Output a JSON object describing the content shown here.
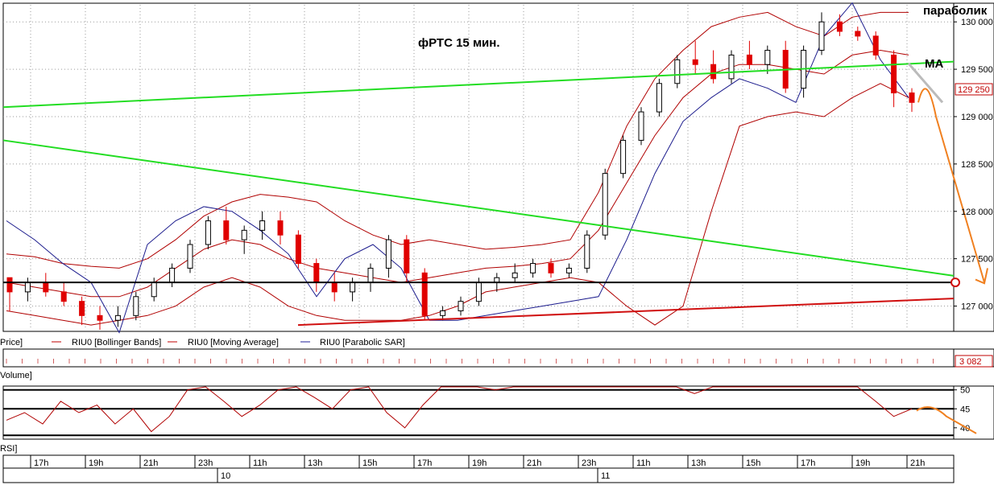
{
  "annotations": {
    "title": "фРТС   15 мин.",
    "parabolic": "параболик",
    "ma": "MA"
  },
  "panels": {
    "price_label": "Price]",
    "legend": [
      {
        "text": "RIU0 [Bollinger Bands]",
        "color": "#c00000"
      },
      {
        "text": "RIU0 [Moving Average]",
        "color": "#c00000"
      },
      {
        "text": "RIU0 [Parabolic SAR]",
        "color": "#1f1f99"
      }
    ],
    "volume_label": "Volume]",
    "volume_value": "3 082",
    "rsi_label": "RSI]",
    "current_price_label": "129 250"
  },
  "time_axis": {
    "hours": [
      "17h",
      "19h",
      "21h",
      "23h",
      "11h",
      "13h",
      "15h",
      "17h",
      "19h",
      "21h",
      "23h",
      "11h",
      "13h",
      "15h",
      "17h",
      "19h",
      "21h"
    ],
    "dates": [
      "10",
      "11"
    ]
  },
  "colors": {
    "up_candle": "#ffffff",
    "down_candle": "#e00000",
    "bollinger": "#b00000",
    "sar": "#1a1a8c",
    "green_line": "#22dd22",
    "support": "#d01010",
    "forecast": "#f08020",
    "level_line": "#000000"
  },
  "chart_data": [
    {
      "type": "candlestick",
      "title": "фРТС   15 мин.",
      "ylim": [
        126750,
        130180
      ],
      "y_ticks": [
        "130 000",
        "129 500",
        "129 000",
        "128 500",
        "128 000",
        "127 500",
        "127 000"
      ],
      "y_tick_values": [
        130000,
        129500,
        129000,
        128500,
        128000,
        127500,
        127000
      ],
      "current_price": 129250,
      "horizontal_level": 127250,
      "series": [
        {
          "name": "RIU0 [Bollinger Bands]",
          "role": "upper",
          "values": [
            127550,
            127520,
            127450,
            127420,
            127400,
            127500,
            127700,
            127950,
            128100,
            128180,
            128150,
            128100,
            127900,
            127750,
            127650,
            127700,
            127650,
            127600,
            127620,
            127650,
            127700,
            128200,
            128900,
            129400,
            129700,
            129950,
            130050,
            130100,
            129950,
            129850,
            130050,
            130100,
            130100
          ]
        },
        {
          "name": "RIU0 [Bollinger Bands]",
          "role": "middle",
          "values": [
            127250,
            127200,
            127150,
            127100,
            127100,
            127200,
            127400,
            127600,
            127700,
            127650,
            127500,
            127400,
            127350,
            127300,
            127250,
            127300,
            127350,
            127400,
            127420,
            127450,
            127500,
            127800,
            128300,
            128800,
            129200,
            129450,
            129550,
            129550,
            129500,
            129450,
            129650,
            129700,
            129650
          ]
        },
        {
          "name": "RIU0 [Bollinger Bands]",
          "role": "lower",
          "values": [
            126950,
            126900,
            126850,
            126800,
            126850,
            126900,
            127000,
            127200,
            127300,
            127200,
            127000,
            126900,
            126850,
            126850,
            126850,
            126900,
            127000,
            127150,
            127200,
            127250,
            127300,
            127250,
            127000,
            126800,
            127000,
            128000,
            128900,
            129000,
            129050,
            129000,
            129200,
            129350,
            129200
          ]
        },
        {
          "name": "RIU0 [Parabolic SAR]",
          "values": [
            127900,
            127700,
            127450,
            127250,
            126720,
            127650,
            127900,
            128050,
            128000,
            127800,
            127550,
            127100,
            127500,
            127650,
            127400,
            126850,
            126850,
            126900,
            126950,
            127000,
            127050,
            127100,
            127700,
            128400,
            128950,
            129200,
            129400,
            129300,
            129150,
            129850,
            130200,
            129600,
            129200
          ]
        },
        {
          "name": "trend-upper-green",
          "values": [
            129100,
            129580
          ]
        },
        {
          "name": "trend-lower-green",
          "values": [
            128750,
            127320
          ]
        },
        {
          "name": "support-red",
          "values": [
            126800,
            127080
          ]
        }
      ],
      "candles": [
        [
          127300,
          127300,
          126950,
          127150
        ],
        [
          127150,
          127300,
          127050,
          127250
        ],
        [
          127250,
          127350,
          127100,
          127150
        ],
        [
          127150,
          127250,
          127000,
          127050
        ],
        [
          127050,
          127100,
          126800,
          126900
        ],
        [
          126900,
          127000,
          126750,
          126850
        ],
        [
          126850,
          127000,
          126780,
          126900
        ],
        [
          126900,
          127150,
          126850,
          127100
        ],
        [
          127100,
          127300,
          127050,
          127250
        ],
        [
          127250,
          127450,
          127200,
          127400
        ],
        [
          127400,
          127700,
          127350,
          127650
        ],
        [
          127650,
          127950,
          127600,
          127900
        ],
        [
          127900,
          128050,
          127650,
          127700
        ],
        [
          127700,
          127850,
          127550,
          127800
        ],
        [
          127800,
          128000,
          127700,
          127900
        ],
        [
          127900,
          128000,
          127650,
          127750
        ],
        [
          127750,
          127800,
          127400,
          127450
        ],
        [
          127450,
          127500,
          127150,
          127250
        ],
        [
          127250,
          127350,
          127050,
          127150
        ],
        [
          127150,
          127300,
          127050,
          127250
        ],
        [
          127250,
          127450,
          127150,
          127400
        ],
        [
          127400,
          127750,
          127300,
          127700
        ],
        [
          127700,
          127750,
          127250,
          127350
        ],
        [
          127350,
          127400,
          126850,
          126900
        ],
        [
          126900,
          127000,
          126850,
          126950
        ],
        [
          126950,
          127100,
          126900,
          127050
        ],
        [
          127050,
          127300,
          127000,
          127250
        ],
        [
          127250,
          127350,
          127150,
          127300
        ],
        [
          127300,
          127450,
          127250,
          127350
        ],
        [
          127350,
          127500,
          127300,
          127450
        ],
        [
          127450,
          127500,
          127300,
          127350
        ],
        [
          127350,
          127450,
          127300,
          127400
        ],
        [
          127400,
          127800,
          127350,
          127750
        ],
        [
          127750,
          128450,
          127700,
          128400
        ],
        [
          128400,
          128800,
          128350,
          128750
        ],
        [
          128750,
          129100,
          128700,
          129050
        ],
        [
          129050,
          129400,
          129000,
          129350
        ],
        [
          129350,
          129650,
          129300,
          129600
        ],
        [
          129600,
          129800,
          129450,
          129550
        ],
        [
          129550,
          129700,
          129350,
          129400
        ],
        [
          129400,
          129700,
          129350,
          129650
        ],
        [
          129650,
          129800,
          129500,
          129550
        ],
        [
          129550,
          129750,
          129450,
          129700
        ],
        [
          129700,
          129800,
          129250,
          129300
        ],
        [
          129300,
          129750,
          129200,
          129700
        ],
        [
          129700,
          130100,
          129650,
          130000
        ],
        [
          130000,
          130080,
          129850,
          129900
        ],
        [
          129900,
          129950,
          129800,
          129850
        ],
        [
          129850,
          129900,
          129600,
          129650
        ],
        [
          129650,
          129700,
          129100,
          129250
        ],
        [
          129250,
          129300,
          129050,
          129150
        ]
      ]
    },
    {
      "type": "line",
      "title": "RSI",
      "ylim": [
        37,
        51
      ],
      "y_ticks": [
        "50",
        "45",
        "40"
      ],
      "y_tick_values": [
        50,
        45,
        40
      ],
      "levels": [
        50,
        45,
        38
      ],
      "series": [
        {
          "name": "RSI",
          "values": [
            42,
            44,
            41,
            47,
            44,
            46,
            41,
            45,
            39,
            43,
            50,
            51,
            47,
            43,
            46,
            50,
            51,
            48,
            45,
            50,
            51,
            44,
            40,
            46,
            51,
            51,
            51,
            50,
            51,
            51,
            51,
            51,
            51,
            51,
            51,
            51,
            51,
            51,
            49,
            51,
            51,
            51,
            51,
            51,
            51,
            51,
            51,
            51,
            47,
            43,
            45
          ]
        }
      ]
    }
  ]
}
